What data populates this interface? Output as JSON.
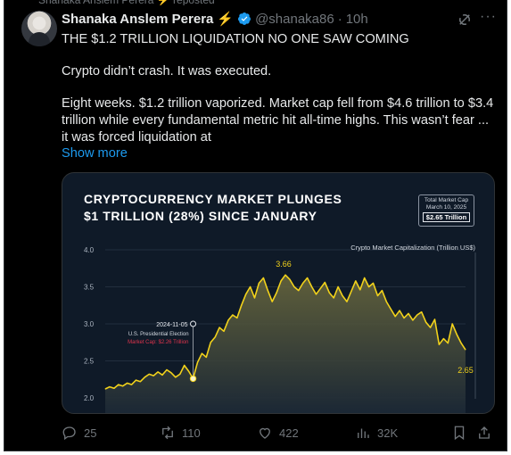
{
  "tweet": {
    "author_name": "Shanaka Anslem Perera",
    "handle": "@shanaka86",
    "separator": "·",
    "time": "10h",
    "lines": [
      "THE $1.2 TRILLION LIQUIDATION NO ONE SAW COMING",
      "Crypto didn’t crash. It was executed.",
      "Eight weeks. $1.2 trillion vaporized. Market cap fell from $4.6 trillion to $3.4",
      "trillion while every fundamental metric hit all-time highs. This wasn’t fear ...",
      "it was forced liquidation at"
    ],
    "show_more": "Show more"
  },
  "media": {
    "title_line1": "CRYPTOCURRENCY MARKET PLUNGES",
    "title_line2": "$1 TRILLION (28%) SINCE JANUARY",
    "badge_line1": "Total Market Cap",
    "badge_line2": "March 10, 2025",
    "badge_value": "$2.65 Trillion"
  },
  "chart_data": {
    "type": "area",
    "series_label": "Crypto Market Capitalization (Trillion US$)",
    "yticks": [
      "4.0",
      "3.5",
      "3.0",
      "2.5",
      "2.0"
    ],
    "ylim": [
      1.9,
      4.0
    ],
    "y": [
      2.12,
      2.15,
      2.13,
      2.18,
      2.16,
      2.2,
      2.18,
      2.24,
      2.22,
      2.28,
      2.32,
      2.3,
      2.35,
      2.31,
      2.38,
      2.34,
      2.28,
      2.32,
      2.44,
      2.36,
      2.26,
      2.48,
      2.6,
      2.55,
      2.75,
      2.82,
      2.95,
      2.9,
      3.05,
      3.12,
      3.08,
      3.25,
      3.4,
      3.5,
      3.35,
      3.55,
      3.62,
      3.45,
      3.3,
      3.42,
      3.58,
      3.66,
      3.6,
      3.5,
      3.45,
      3.55,
      3.62,
      3.5,
      3.4,
      3.48,
      3.56,
      3.42,
      3.35,
      3.5,
      3.38,
      3.3,
      3.44,
      3.58,
      3.46,
      3.62,
      3.5,
      3.55,
      3.38,
      3.45,
      3.3,
      3.2,
      3.1,
      3.18,
      3.08,
      3.14,
      3.05,
      3.12,
      3.16,
      3.02,
      2.95,
      3.06,
      2.72,
      2.8,
      2.74,
      3.0,
      2.86,
      2.74,
      2.65
    ],
    "annotations": {
      "peak": "3.66",
      "last": "2.65",
      "event_date": "2024-11-05",
      "event_name": "U.S. Presidential Election",
      "event_cap": "Market Cap: $2.26 Trillion"
    },
    "event_value": 2.26,
    "colors": {
      "line": "#f2d21b",
      "event_text": "#e0344d"
    }
  },
  "actions": {
    "replies": "25",
    "reposts": "110",
    "likes": "422",
    "views": "32K"
  }
}
